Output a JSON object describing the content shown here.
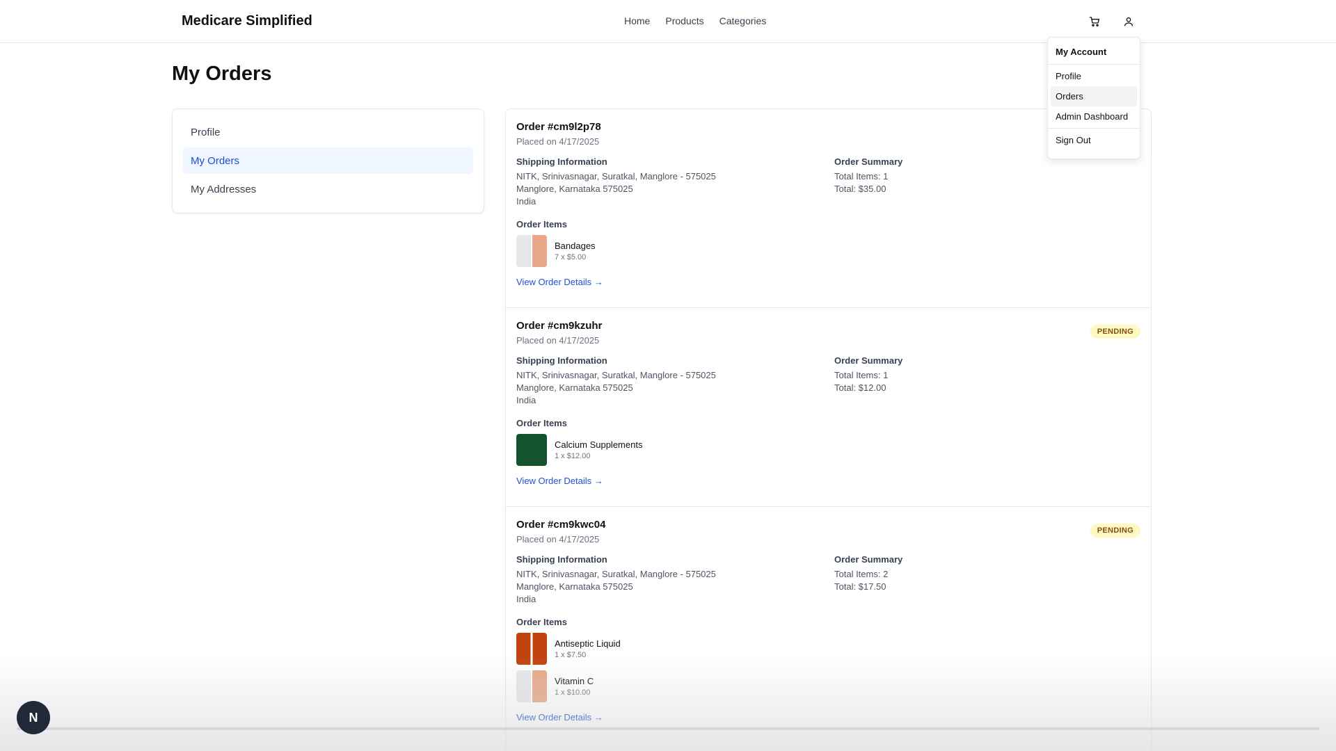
{
  "header": {
    "brand": "Medicare Simplified",
    "nav": [
      "Home",
      "Products",
      "Categories"
    ],
    "icons": [
      "cart-icon",
      "user-icon"
    ]
  },
  "page_title": "My Orders",
  "sidebar": {
    "items": [
      {
        "label": "Profile",
        "active": false
      },
      {
        "label": "My Orders",
        "active": true
      },
      {
        "label": "My Addresses",
        "active": false
      }
    ]
  },
  "labels": {
    "shipping": "Shipping Information",
    "summary": "Order Summary",
    "items": "Order Items",
    "view": "View Order Details →"
  },
  "orders": [
    {
      "id": "Order #cm9l2p78",
      "placed": "Placed on 4/17/2025",
      "status": "",
      "address": [
        "NITK, Srinivasnagar, Suratkal, Manglore - 575025",
        "Manglore, Karnataka 575025",
        "India"
      ],
      "total_items": "Total Items: 1",
      "total": "Total: $35.00",
      "items": [
        {
          "name": "Bandages",
          "qty": "7 x $5.00",
          "thumb": "bandage"
        }
      ]
    },
    {
      "id": "Order #cm9kzuhr",
      "placed": "Placed on 4/17/2025",
      "status": "PENDING",
      "address": [
        "NITK, Srinivasnagar, Suratkal, Manglore - 575025",
        "Manglore, Karnataka 575025",
        "India"
      ],
      "total_items": "Total Items: 1",
      "total": "Total: $12.00",
      "items": [
        {
          "name": "Calcium Supplements",
          "qty": "1 x $12.00",
          "thumb": "calcium"
        }
      ]
    },
    {
      "id": "Order #cm9kwc04",
      "placed": "Placed on 4/17/2025",
      "status": "PENDING",
      "address": [
        "NITK, Srinivasnagar, Suratkal, Manglore - 575025",
        "Manglore, Karnataka 575025",
        "India"
      ],
      "total_items": "Total Items: 2",
      "total": "Total: $17.50",
      "items": [
        {
          "name": "Antiseptic Liquid",
          "qty": "1 x $7.50",
          "thumb": "antiseptic"
        },
        {
          "name": "Vitamin C",
          "qty": "1 x $10.00",
          "thumb": "bandage"
        }
      ]
    }
  ],
  "dropdown": {
    "label": "My Account",
    "items": [
      "Profile",
      "Orders",
      "Admin Dashboard"
    ],
    "highlighted": "Orders",
    "signout": "Sign Out"
  },
  "badge": "N",
  "colors": {
    "accent": "#1d4ed8",
    "pending_bg": "#fef9c3",
    "pending_text": "#854d0e"
  }
}
